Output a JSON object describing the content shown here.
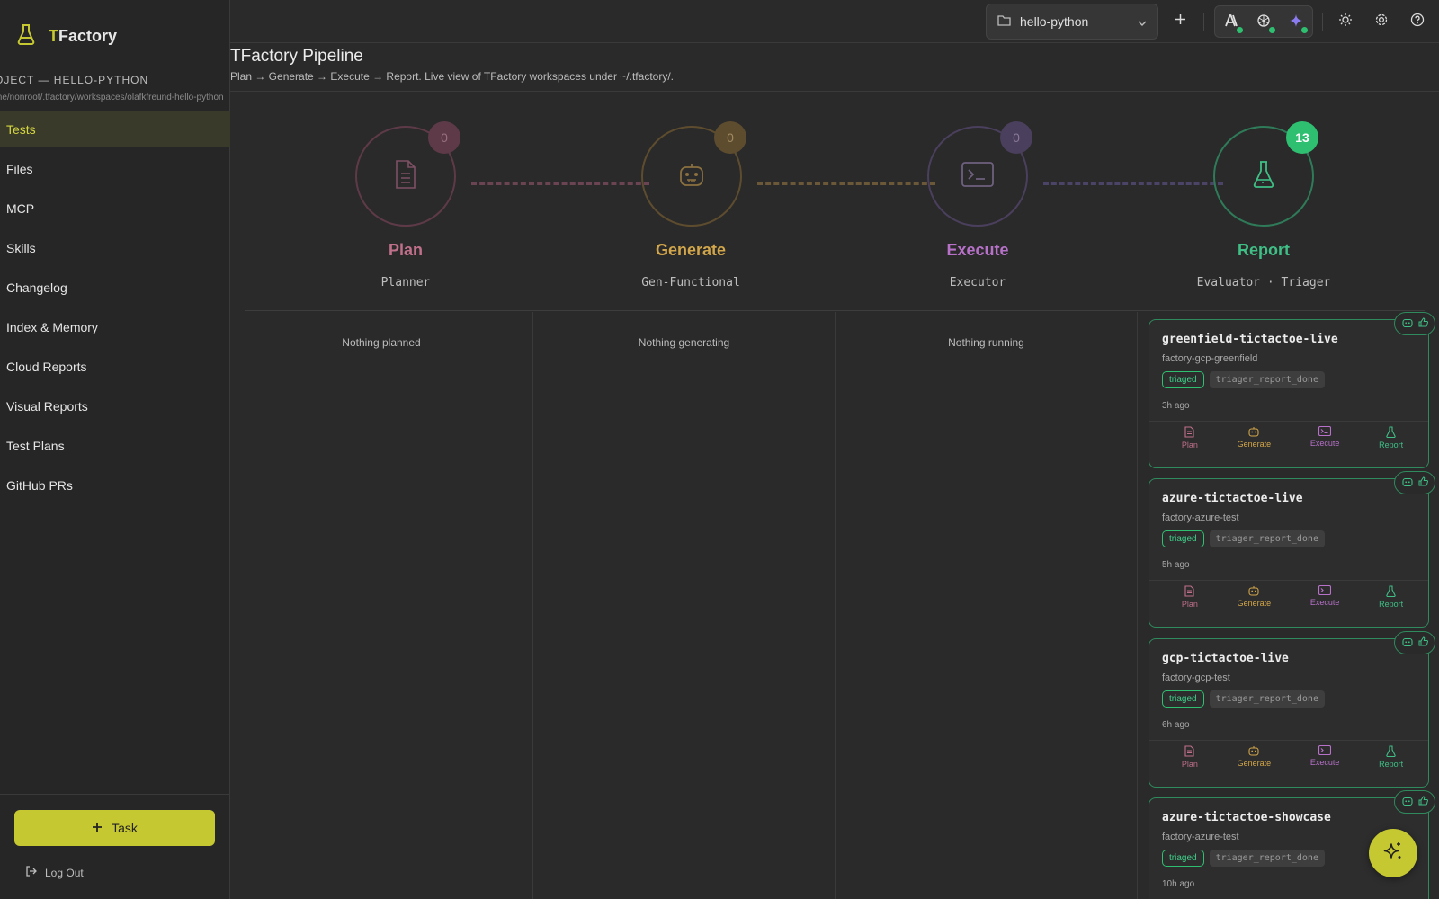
{
  "brand": {
    "prefix": "T",
    "rest": "Factory"
  },
  "sidebar": {
    "project_label": "OJECT — HELLO-PYTHON",
    "project_path": "me/nonroot/.tfactory/workspaces/olafkfreund-hello-python",
    "items": [
      {
        "label": "Tests",
        "active": true
      },
      {
        "label": "Files"
      },
      {
        "label": "MCP"
      },
      {
        "label": "Skills"
      },
      {
        "label": "Changelog"
      },
      {
        "label": "Index & Memory"
      },
      {
        "label": "Cloud Reports"
      },
      {
        "label": "Visual Reports"
      },
      {
        "label": "Test Plans"
      },
      {
        "label": "GitHub PRs"
      }
    ],
    "task_button": "Task",
    "logout": "Log Out"
  },
  "topbar": {
    "project": "hello-python"
  },
  "header": {
    "title": "TFactory Pipeline",
    "subtitle": "Plan → Generate → Execute → Report. Live view of TFactory workspaces under ~/.tfactory/."
  },
  "stages": [
    {
      "name": "Plan",
      "role": "Planner",
      "count": "0",
      "color": "#c0708a",
      "empty": "Nothing planned"
    },
    {
      "name": "Generate",
      "role": "Gen-Functional",
      "count": "0",
      "color": "#d2a64a",
      "empty": "Nothing generating"
    },
    {
      "name": "Execute",
      "role": "Executor",
      "count": "0",
      "color": "#b771c9",
      "empty": "Nothing running"
    },
    {
      "name": "Report",
      "role": "Evaluator · Triager",
      "count": "13",
      "color": "#3fbf86"
    }
  ],
  "cards": [
    {
      "title": "greenfield-tictactoe-live",
      "sub": "factory-gcp-greenfield",
      "tag": "triaged",
      "status": "triager_report_done",
      "time": "3h ago"
    },
    {
      "title": "azure-tictactoe-live",
      "sub": "factory-azure-test",
      "tag": "triaged",
      "status": "triager_report_done",
      "time": "5h ago"
    },
    {
      "title": "gcp-tictactoe-live",
      "sub": "factory-gcp-test",
      "tag": "triaged",
      "status": "triager_report_done",
      "time": "6h ago"
    },
    {
      "title": "azure-tictactoe-showcase",
      "sub": "factory-azure-test",
      "tag": "triaged",
      "status": "triager_report_done",
      "time": "10h ago"
    }
  ],
  "card_actions": [
    "Plan",
    "Generate",
    "Execute",
    "Report"
  ]
}
